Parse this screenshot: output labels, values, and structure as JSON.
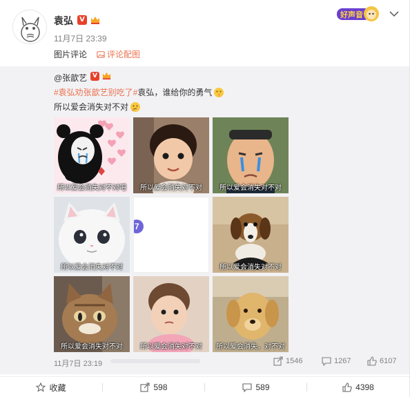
{
  "post": {
    "username": "袁弘",
    "verified_badge": "V",
    "time": "11月7日 23:39",
    "sub_tabs": [
      "图片评论",
      "评论配图"
    ]
  },
  "repost": {
    "user": "@张歆艺",
    "verified_badge": "V",
    "hashtag": "#袁弘劝张歆艺别吃了#",
    "line2_rest": "袁弘，谁给你的勇气",
    "line3": "所以爱会消失对不对",
    "images": [
      {
        "caption": "所以爱会消失对不对吧",
        "subject": "crying-panda-meme"
      },
      {
        "caption": "所以爱会消失对不对",
        "subject": "toddler-smiling"
      },
      {
        "caption": "所以爱会消失对不对",
        "subject": "crying-man-meme"
      },
      {
        "caption": "所以爱会消失对不对",
        "subject": "sad-white-cat"
      },
      {
        "caption": "",
        "subject": "loading-blank",
        "badge": "7"
      },
      {
        "caption": "所以爱会消失对不对",
        "subject": "beagle-puppy"
      },
      {
        "caption": "所以爱会消失对不对",
        "subject": "grumpy-tabby-cat"
      },
      {
        "caption": "所以爱会消失对不对",
        "subject": "baby-girl"
      },
      {
        "caption": "所以爱会消失，对不对",
        "subject": "golden-retriever"
      }
    ],
    "time": "11月7日 23:19",
    "forward_count": "1546",
    "comment_count": "1267",
    "like_count": "6107"
  },
  "actions": {
    "collect": "收藏",
    "forward": "598",
    "comment": "589",
    "like": "4398"
  },
  "colors": {
    "accent": "#eb7350",
    "badge": "#e8402a",
    "repost_bg": "#f2f2f5"
  }
}
